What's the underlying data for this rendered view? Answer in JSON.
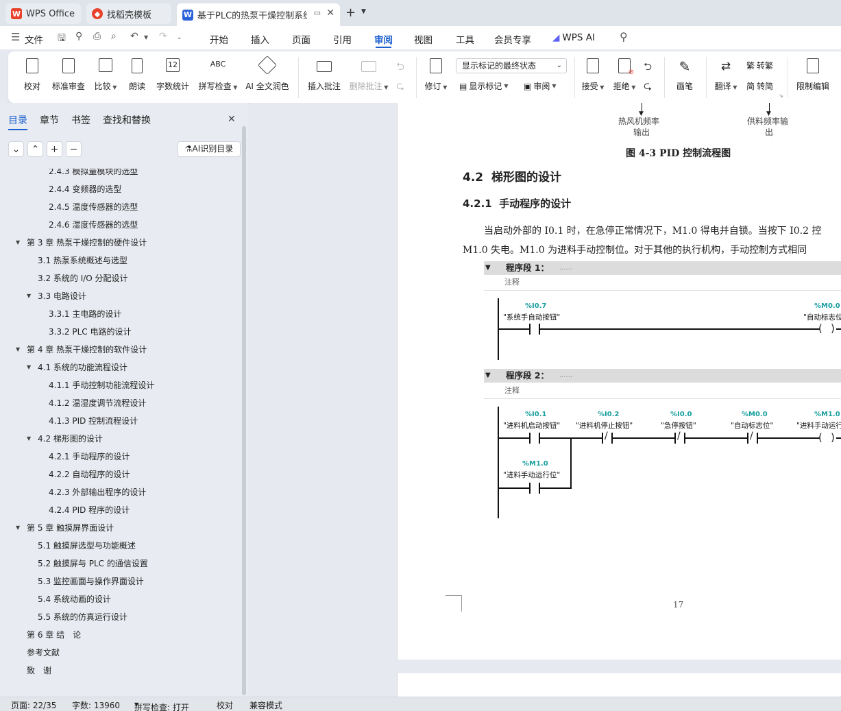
{
  "tabs": [
    {
      "label": "WPS Office"
    },
    {
      "label": "找稻壳模板"
    },
    {
      "label": "基于PLC的热泵干燥控制系统"
    }
  ],
  "menu": {
    "file": "文件",
    "items": [
      "开始",
      "插入",
      "页面",
      "引用",
      "审阅",
      "视图",
      "工具",
      "会员专享"
    ],
    "selected": "审阅",
    "ai": "WPS AI"
  },
  "ribbon": {
    "proofread": "校对",
    "standard_review": "标准审查",
    "compare": "比较",
    "read_aloud": "朗读",
    "word_count": "字数统计",
    "spell_check": "拼写检查",
    "ai_polish": "AI 全文润色",
    "insert_comment": "插入批注",
    "delete_comment": "删除批注",
    "track_changes": "修订",
    "markup_state": "显示标记的最终状态",
    "show_markup": "显示标记",
    "review": "审阅",
    "accept": "接受",
    "reject": "拒绝",
    "pen": "画笔",
    "translate": "翻译",
    "to_traditional": "转繁",
    "to_simplified": "转简",
    "restrict_edit": "限制编辑",
    "word_count_icon_text": "12",
    "spell_icon_text": "ABC"
  },
  "sidebar": {
    "tabs": [
      "目录",
      "章节",
      "书签",
      "查找和替换"
    ],
    "ai_toc": "AI识别目录",
    "toc": [
      {
        "label": "2.4.3 模拟量模块的选型",
        "level": 3
      },
      {
        "label": "2.4.4 变频器的选型",
        "level": 3
      },
      {
        "label": "2.4.5 温度传感器的选型",
        "level": 3
      },
      {
        "label": "2.4.6 湿度传感器的选型",
        "level": 3
      },
      {
        "label": "第 3 章 热泵干燥控制的硬件设计",
        "level": 1,
        "expanded": true
      },
      {
        "label": "3.1 热泵系统概述与选型",
        "level": 2
      },
      {
        "label": "3.2 系统的 I/O 分配设计",
        "level": 2
      },
      {
        "label": "3.3 电路设计",
        "level": 2,
        "expanded": true
      },
      {
        "label": "3.3.1 主电路的设计",
        "level": 3
      },
      {
        "label": "3.3.2 PLC 电路的设计",
        "level": 3
      },
      {
        "label": "第 4 章 热泵干燥控制的软件设计",
        "level": 1,
        "expanded": true
      },
      {
        "label": "4.1 系统的功能流程设计",
        "level": 2,
        "expanded": true
      },
      {
        "label": "4.1.1 手动控制功能流程设计",
        "level": 3
      },
      {
        "label": "4.1.2 温湿度调节流程设计",
        "level": 3
      },
      {
        "label": "4.1.3 PID 控制流程设计",
        "level": 3
      },
      {
        "label": "4.2 梯形图的设计",
        "level": 2,
        "expanded": true
      },
      {
        "label": "4.2.1 手动程序的设计",
        "level": 3
      },
      {
        "label": "4.2.2 自动程序的设计",
        "level": 3
      },
      {
        "label": "4.2.3 外部输出程序的设计",
        "level": 3
      },
      {
        "label": "4.2.4 PID 程序的设计",
        "level": 3
      },
      {
        "label": "第 5 章 触摸屏界面设计",
        "level": 1,
        "expanded": true
      },
      {
        "label": "5.1 触摸屏选型与功能概述",
        "level": 2
      },
      {
        "label": "5.2 触摸屏与 PLC 的通信设置",
        "level": 2
      },
      {
        "label": "5.3 监控画面与操作界面设计",
        "level": 2
      },
      {
        "label": "5.4 系统动画的设计",
        "level": 2
      },
      {
        "label": "5.5 系统的仿真运行设计",
        "level": 2
      },
      {
        "label": "第 6 章 结　论",
        "level": 0
      },
      {
        "label": "参考文献",
        "level": 0
      },
      {
        "label": "致　谢",
        "level": 0
      }
    ]
  },
  "doc": {
    "flow_out1a": "热风机频率",
    "flow_out1b": "输出",
    "flow_out2a": "供料频率输",
    "flow_out2b": "出",
    "fig_caption": "图 4-3 PID 控制流程图",
    "h2": "4.2  梯形图的设计",
    "h3": "4.2.1  手动程序的设计",
    "para1": "当启动外部的 I0.1 时，在急停正常情况下，M1.0 得电并自锁。当按下 I0.2 控",
    "para2": "M1.0 失电。M1.0 为进料手动控制位。对于其他的执行机构，手动控制方式相同",
    "seg1_label": "程序段 1：",
    "seg2_label": "程序段 2：",
    "seg_dots": "......",
    "note": "注释",
    "seg1": {
      "in_addr": "%I0.7",
      "in_name": "\"系统手自动按钮\"",
      "out_addr": "%M0.0",
      "out_name": "\"自动标志位\""
    },
    "seg2": {
      "c1_addr": "%I0.1",
      "c1_name": "\"进料机启动按钮\"",
      "c2_addr": "%I0.2",
      "c2_name": "\"进料机停止按钮\"",
      "c3_addr": "%I0.0",
      "c3_name": "\"急停按钮\"",
      "c4_addr": "%M0.0",
      "c4_name": "\"自动标志位\"",
      "out_addr": "%M1.0",
      "out_name": "\"进料手动运行位\"",
      "p_addr": "%M1.0",
      "p_name": "\"进料手动运行位\""
    },
    "page_number": "17"
  },
  "status": {
    "page": "页面: 22/35",
    "words": "字数: 13960",
    "spell": "拼写检查: 打开",
    "proof": "校对",
    "compat": "兼容模式"
  },
  "colors": {
    "accent": "#1a5fd0",
    "wps_red": "#e8412c",
    "doc_blue": "#2b63d9",
    "ladder_teal": "#1a9e9e"
  }
}
